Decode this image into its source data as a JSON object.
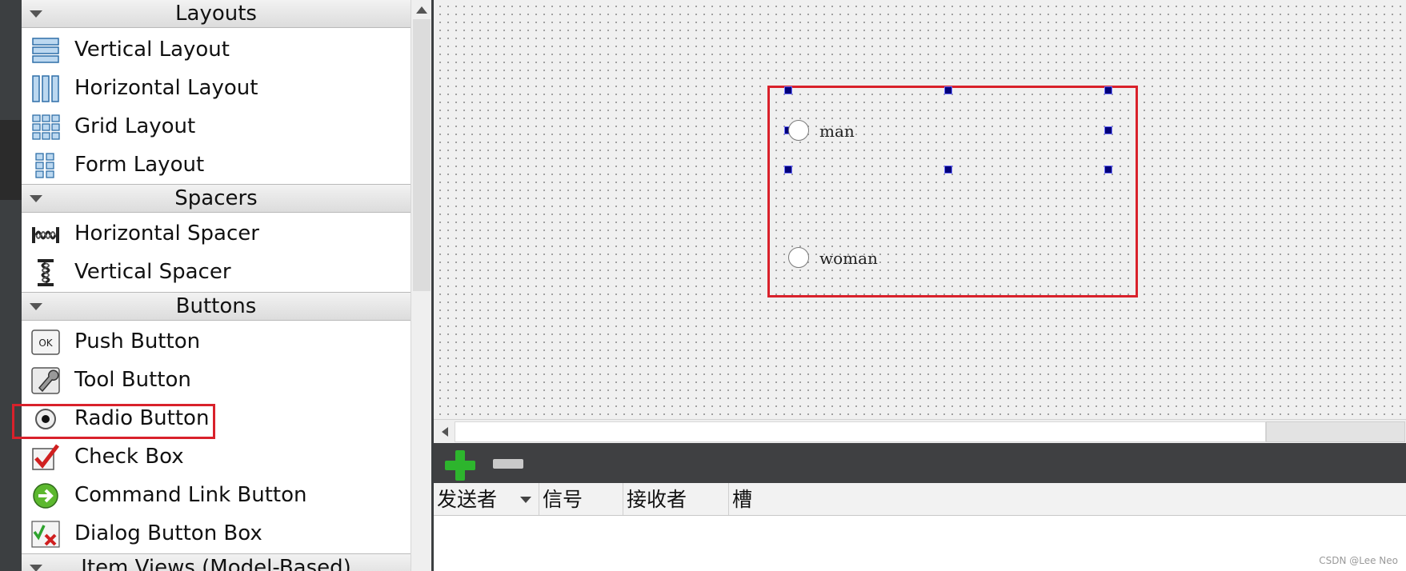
{
  "widget_box": {
    "categories": {
      "layouts": "Layouts",
      "spacers": "Spacers",
      "buttons": "Buttons",
      "item_views": "Item Views (Model-Based)"
    },
    "items": {
      "vertical_layout": "Vertical Layout",
      "horizontal_layout": "Horizontal Layout",
      "grid_layout": "Grid Layout",
      "form_layout": "Form Layout",
      "horizontal_spacer": "Horizontal Spacer",
      "vertical_spacer": "Vertical Spacer",
      "push_button": "Push Button",
      "tool_button": "Tool Button",
      "radio_button": "Radio Button",
      "check_box": "Check Box",
      "command_link_button": "Command Link Button",
      "dialog_button_box": "Dialog Button Box"
    },
    "icons": {
      "push_button_text": "OK"
    }
  },
  "form": {
    "radio_man": "man",
    "radio_woman": "woman"
  },
  "signal_slot": {
    "columns": [
      "发送者",
      "信号",
      "接收者",
      "槽"
    ]
  },
  "colors": {
    "highlight_red": "#d9212b",
    "handle_blue": "#00007a",
    "add_green": "#2db52d"
  },
  "watermark": "CSDN @Lee Neo"
}
